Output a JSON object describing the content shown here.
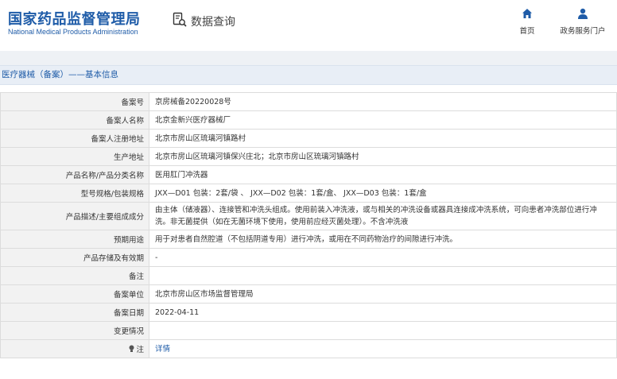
{
  "header": {
    "logo_cn": "国家药品监督管理局",
    "logo_en": "National Medical Products Administration",
    "data_query": "数据查询",
    "nav": [
      {
        "label": "首页",
        "icon": "home-icon"
      },
      {
        "label": "政务服务门户",
        "icon": "user-icon"
      }
    ],
    "accent_color": "#1f5ca8"
  },
  "breadcrumb": "医疗器械（备案）——基本信息",
  "table": {
    "rows": [
      {
        "key": "备案号",
        "value": "京房械备20220028号"
      },
      {
        "key": "备案人名称",
        "value": "北京金新兴医疗器械厂"
      },
      {
        "key": "备案人注册地址",
        "value": "北京市房山区琉璃河镇路村"
      },
      {
        "key": "生产地址",
        "value": "北京市房山区琉璃河镇保兴庄北；北京市房山区琉璃河镇路村"
      },
      {
        "key": "产品名称/产品分类名称",
        "value": "医用肛门冲洗器"
      },
      {
        "key": "型号规格/包装规格",
        "value": "JXX—D01 包装：2套/袋 、 JXX—D02 包装：1套/盒、 JXX—D03 包装：1套/盒"
      },
      {
        "key": "产品描述/主要组成成分",
        "value": "由主体（储液器）、连接管和冲洗头组成。使用前装入冲洗液，或与相关的冲洗设备或器具连接成冲洗系统，可向患者冲洗部位进行冲洗。非无菌提供（如在无菌环境下使用，使用前应经灭菌处理）。不含冲洗液"
      },
      {
        "key": "预期用途",
        "value": "用于对患者自然腔道（不包括阴道专用）进行冲洗，或用在不同药物治疗的间隙进行冲洗。"
      },
      {
        "key": "产品存储及有效期",
        "value": "-"
      },
      {
        "key": "备注",
        "value": ""
      },
      {
        "key": "备案单位",
        "value": "北京市房山区市场监督管理局"
      },
      {
        "key": "备案日期",
        "value": "2022-04-11"
      },
      {
        "key": "变更情况",
        "value": ""
      },
      {
        "key": "注",
        "value": "详情"
      }
    ]
  }
}
